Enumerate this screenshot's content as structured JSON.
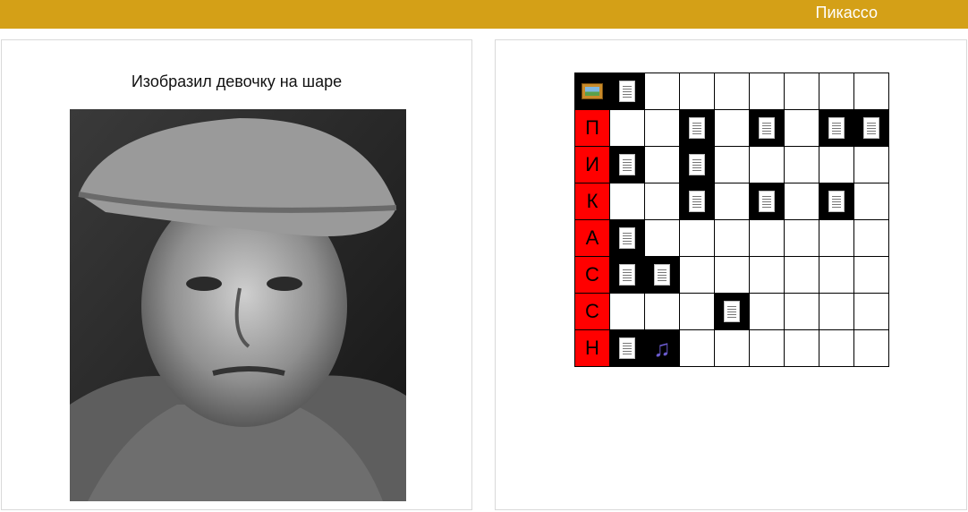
{
  "header": {
    "title": "Пикассо",
    "bar_color": "#d4a017"
  },
  "left_panel": {
    "caption": "Изобразил девочку на шаре",
    "photo": {
      "alt": "portrait-photo"
    }
  },
  "crossword": {
    "colors": {
      "letter_cell": "#ff0000",
      "filled_cell": "#000000"
    },
    "rows": [
      [
        "icon:picture",
        "icon:doc",
        "",
        "",
        "",
        "",
        "",
        "",
        ""
      ],
      [
        "letter:П",
        "",
        "",
        "icon:doc",
        "",
        "icon:doc",
        "",
        "icon:doc",
        "icon:doc"
      ],
      [
        "letter:И",
        "icon:doc",
        "",
        "icon:doc",
        "",
        "",
        "",
        "",
        ""
      ],
      [
        "letter:К",
        "",
        "",
        "icon:doc",
        "",
        "icon:doc",
        "",
        "icon:doc",
        ""
      ],
      [
        "letter:А",
        "icon:doc",
        "",
        "",
        "",
        "",
        "",
        "",
        ""
      ],
      [
        "letter:С",
        "icon:doc",
        "icon:doc",
        "",
        "",
        "",
        "",
        "",
        ""
      ],
      [
        "letter:С",
        "",
        "",
        "",
        "icon:doc",
        "",
        "",
        "",
        ""
      ],
      [
        "letter:Н",
        "icon:doc",
        "icon:music",
        "",
        "",
        "",
        "",
        "",
        ""
      ]
    ]
  }
}
